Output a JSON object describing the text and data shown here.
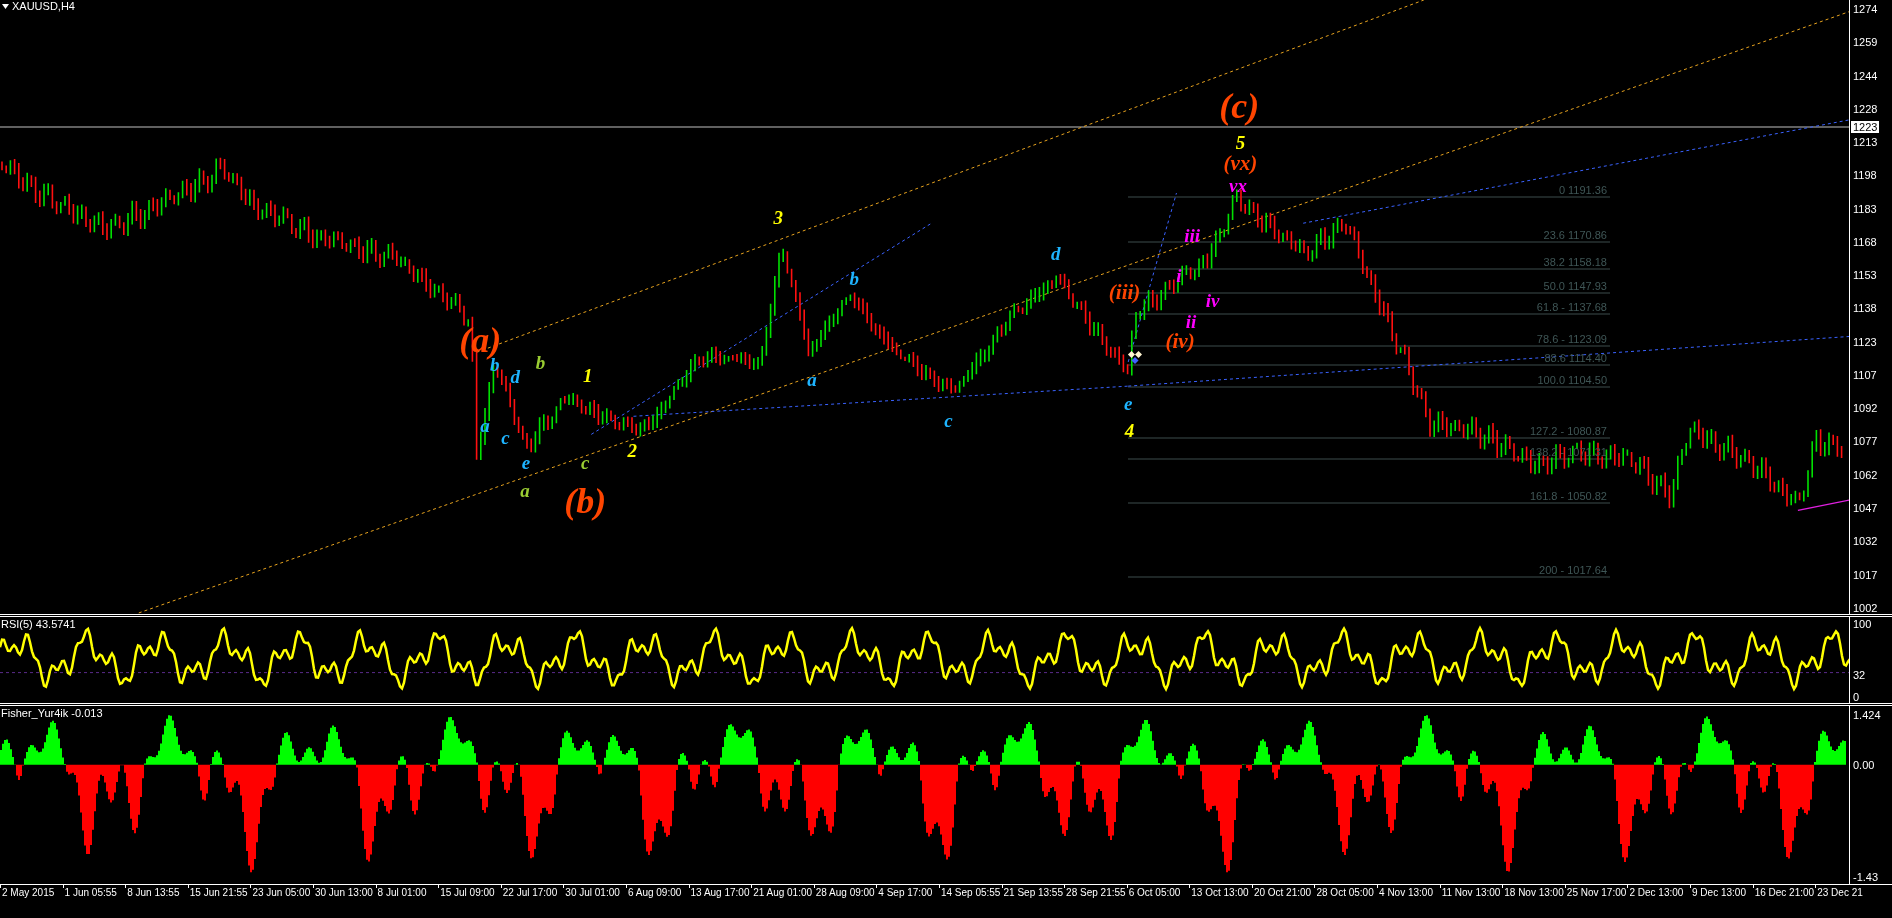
{
  "chart": {
    "symbol": "XAUUSD,H4",
    "price_axis": [
      "1274",
      "1259",
      "1244",
      "1228",
      "1213",
      "1198",
      "1183",
      "1168",
      "1153",
      "1138",
      "1123",
      "1107",
      "1092",
      "1077",
      "1062",
      "1047",
      "1032",
      "1017",
      "1002"
    ],
    "current_price": "1223",
    "fib_levels": [
      "0 1191.36",
      "23.6 1170.86",
      "38.2 1158.18",
      "50.0 1147.93",
      "61.8 - 1137.68",
      "78.6 - 1123.09",
      "88.6 1114.40",
      "100.0 1104.50",
      "127.2 - 1080.87",
      "138.2 - 1071.31",
      "161.8 - 1050.82",
      "200 - 1017.64"
    ],
    "wave_labels": [
      {
        "text": "(c)",
        "color": "#ff4500",
        "kind": "primary"
      },
      {
        "text": "5",
        "color": "#ffff00",
        "kind": "minor"
      },
      {
        "text": "(vx)",
        "color": "#ff4500",
        "kind": "intermediate"
      },
      {
        "text": "vx",
        "color": "#ff00ff",
        "kind": "minor"
      },
      {
        "text": "3",
        "color": "#ffff00",
        "kind": "minor"
      },
      {
        "text": "iii",
        "color": "#ff00ff",
        "kind": "minor"
      },
      {
        "text": "d",
        "color": "#1eb4ff",
        "kind": "minor"
      },
      {
        "text": "b",
        "color": "#1eb4ff",
        "kind": "minor"
      },
      {
        "text": "(iii)",
        "color": "#ff4500",
        "kind": "intermediate"
      },
      {
        "text": "i",
        "color": "#ff00ff",
        "kind": "minor"
      },
      {
        "text": "iv",
        "color": "#ff00ff",
        "kind": "minor"
      },
      {
        "text": "ii",
        "color": "#ff00ff",
        "kind": "minor"
      },
      {
        "text": "(a)",
        "color": "#ff4500",
        "kind": "primary"
      },
      {
        "text": "(iv)",
        "color": "#ff4500",
        "kind": "intermediate"
      },
      {
        "text": "b",
        "color": "#1eb4ff",
        "kind": "minor"
      },
      {
        "text": "d",
        "color": "#1eb4ff",
        "kind": "minor"
      },
      {
        "text": "b",
        "color": "#9acd32",
        "kind": "minor"
      },
      {
        "text": "1",
        "color": "#ffff00",
        "kind": "minor"
      },
      {
        "text": "a",
        "color": "#1eb4ff",
        "kind": "minor"
      },
      {
        "text": "a",
        "color": "#1eb4ff",
        "kind": "minor"
      },
      {
        "text": "c",
        "color": "#1eb4ff",
        "kind": "minor"
      },
      {
        "text": "c",
        "color": "#1eb4ff",
        "kind": "minor"
      },
      {
        "text": "e",
        "color": "#1eb4ff",
        "kind": "minor"
      },
      {
        "text": "4",
        "color": "#ffff00",
        "kind": "minor"
      },
      {
        "text": "e",
        "color": "#1eb4ff",
        "kind": "minor"
      },
      {
        "text": "c",
        "color": "#9acd32",
        "kind": "minor"
      },
      {
        "text": "2",
        "color": "#ffff00",
        "kind": "minor"
      },
      {
        "text": "a",
        "color": "#9acd32",
        "kind": "minor"
      },
      {
        "text": "(b)",
        "color": "#ff4500",
        "kind": "primary"
      }
    ]
  },
  "rsi": {
    "title": "RSI(5) 43.5741",
    "axis": [
      "100",
      "32",
      "0"
    ]
  },
  "fisher": {
    "title": "Fisher_Yur4ik -0.013",
    "axis": [
      "1.424",
      "0.00",
      "-1.43"
    ]
  },
  "time_axis": [
    "2 May 2015",
    "1 Jun 05:55",
    "8 Jun 13:55",
    "15 Jun 21:55",
    "23 Jun 05:00",
    "30 Jun 13:00",
    "8 Jul 01:00",
    "15 Jul 09:00",
    "22 Jul 17:00",
    "30 Jul 01:00",
    "6 Aug 09:00",
    "13 Aug 17:00",
    "21 Aug 01:00",
    "28 Aug 09:00",
    "4 Sep 17:00",
    "14 Sep 05:55",
    "21 Sep 13:55",
    "28 Sep 21:55",
    "6 Oct 05:00",
    "13 Oct 13:00",
    "20 Oct 21:00",
    "28 Oct 05:00",
    "4 Nov 13:00",
    "11 Nov 13:00",
    "18 Nov 13:00",
    "25 Nov 17:00",
    "2 Dec 13:00",
    "9 Dec 13:00",
    "16 Dec 21:00",
    "23 Dec 21"
  ]
}
